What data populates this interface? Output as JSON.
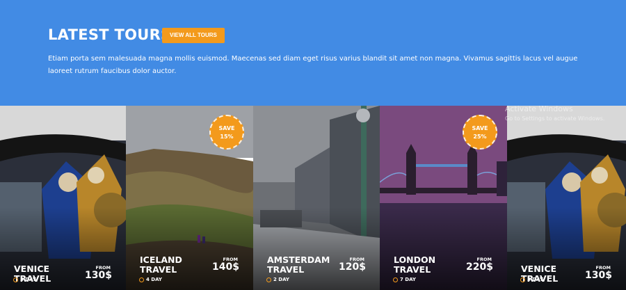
{
  "section": {
    "title": "LATEST TOURS",
    "view_all_label": "VIEW ALL TOURS",
    "description": "Etiam porta sem malesuada magna mollis euismod. Maecenas sed diam eget risus varius blandit sit amet non magna. Vivamus sagittis lacus vel augue laoreet rutrum faucibus dolor auctor."
  },
  "tours": [
    {
      "name": "VENICE TRAVEL",
      "days": "3 DAY",
      "from_label": "FROM",
      "price": "130$"
    },
    {
      "name": "ICELAND TRAVEL",
      "days": "4 DAY",
      "from_label": "FROM",
      "price": "140$",
      "save_label": "SAVE",
      "save_value": "15%"
    },
    {
      "name": "AMSTERDAM TRAVEL",
      "days": "2 DAY",
      "from_label": "FROM",
      "price": "120$"
    },
    {
      "name": "LONDON TRAVEL",
      "days": "7 DAY",
      "from_label": "FROM",
      "price": "220$",
      "save_label": "SAVE",
      "save_value": "25%"
    },
    {
      "name": "VENICE TRAVEL",
      "days": "3 DAY",
      "from_label": "FROM",
      "price": "130$"
    }
  ],
  "watermark": {
    "line1": "Activate Windows",
    "line2": "Go to Settings to activate Windows."
  },
  "colors": {
    "header_bg": "#428be4",
    "accent": "#f39a1c"
  }
}
